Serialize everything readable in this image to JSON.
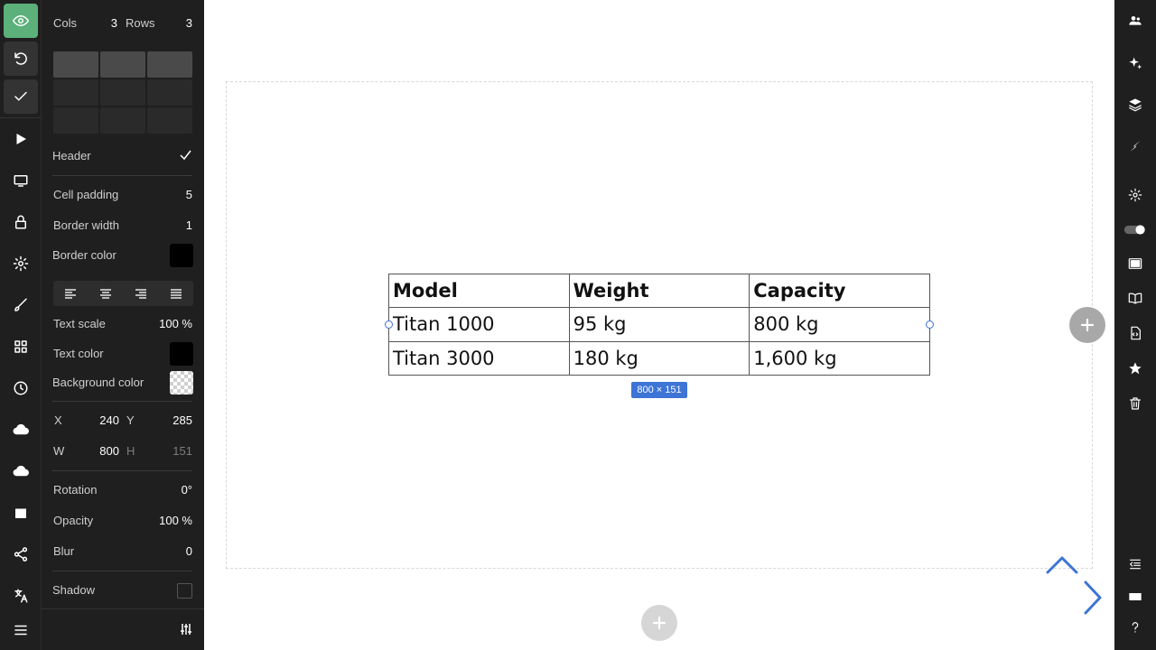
{
  "colors": {
    "accent": "#3d74d6",
    "preview_button": "#5cb07a",
    "panel_bg": "#1f1f1f",
    "border_color_value": "#000000",
    "text_color_value": "#000000"
  },
  "left_rail": {
    "icons": [
      "eye-icon",
      "undo-icon",
      "check-icon",
      "play-icon",
      "monitor-icon",
      "lock-icon",
      "gear-icon",
      "brush-icon",
      "grid-icon",
      "clock-icon",
      "cloud-upload-icon",
      "cloud-download-icon",
      "image-icon",
      "share-icon",
      "translate-icon",
      "menu-icon"
    ]
  },
  "panel": {
    "cols_label": "Cols",
    "cols_value": "3",
    "rows_label": "Rows",
    "rows_value": "3",
    "header_label": "Header",
    "header_checked": true,
    "cell_padding_label": "Cell padding",
    "cell_padding_value": "5",
    "border_width_label": "Border width",
    "border_width_value": "1",
    "border_color_label": "Border color",
    "text_alignment_options": [
      "left",
      "center",
      "right",
      "justify"
    ],
    "text_scale_label": "Text scale",
    "text_scale_value": "100 %",
    "text_color_label": "Text color",
    "background_color_label": "Background color",
    "x_label": "X",
    "x_value": "240",
    "y_label": "Y",
    "y_value": "285",
    "w_label": "W",
    "w_value": "800",
    "h_label": "H",
    "h_value": "151",
    "rotation_label": "Rotation",
    "rotation_value": "0°",
    "opacity_label": "Opacity",
    "opacity_value": "100 %",
    "blur_label": "Blur",
    "blur_value": "0",
    "shadow_label": "Shadow",
    "shadow_checked": false
  },
  "canvas": {
    "table": {
      "headers": [
        "Model",
        "Weight",
        "Capacity"
      ],
      "rows": [
        [
          "Titan 1000",
          "95 kg",
          "800 kg"
        ],
        [
          "Titan 3000",
          "180 kg",
          "1,600 kg"
        ]
      ]
    },
    "size_tooltip": "800 × 151"
  },
  "right_rail": {
    "icons": [
      "users-icon",
      "sparkles-icon",
      "layers-icon",
      "lightning-icon",
      "gear-icon",
      "toggle-icon",
      "display-icon",
      "book-icon",
      "code-file-icon",
      "star-icon",
      "trash-icon",
      "outdent-icon",
      "keyboard-icon",
      "help-icon"
    ]
  }
}
